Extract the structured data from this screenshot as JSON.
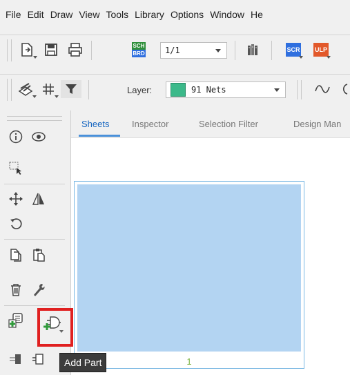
{
  "menubar": {
    "items": [
      "File",
      "Edit",
      "Draw",
      "View",
      "Tools",
      "Library",
      "Options",
      "Window",
      "He"
    ]
  },
  "toolbar_top": {
    "sheet_value": "1/1",
    "sch_brd_badge": [
      "SCH",
      "BRD"
    ],
    "scr_badge": "SCR",
    "ulp_badge": "ULP",
    "colors": {
      "scr": "#2f6fdf",
      "ulp": "#e2582a",
      "sch": "#2f8f3a",
      "brd": "#2f6fdf"
    }
  },
  "toolbar_layer": {
    "layer_label": "Layer:",
    "layer_value": "91 Nets",
    "layer_color": "#3cb98a"
  },
  "tabs": [
    {
      "label": "Sheets",
      "active": true
    },
    {
      "label": "Inspector",
      "active": false
    },
    {
      "label": "Selection Filter",
      "active": false
    },
    {
      "label": "Design Man",
      "active": false
    }
  ],
  "sheets": {
    "sheet_number": "1"
  },
  "tooltip": {
    "text": "Add Part"
  },
  "icons": [
    "info-icon",
    "eye-icon",
    "select-icon",
    "move-icon",
    "mirror-icon",
    "rotate-icon",
    "copy-icon",
    "paste-icon",
    "delete-icon",
    "wrench-icon",
    "library-add-icon",
    "add-part-icon",
    "pin-icon",
    "gate-icon"
  ]
}
